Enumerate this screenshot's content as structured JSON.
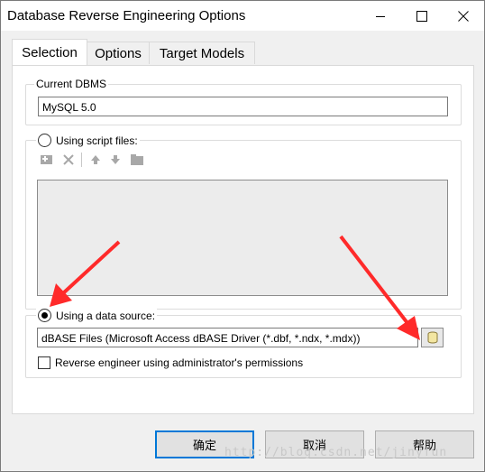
{
  "window": {
    "title": "Database Reverse Engineering Options",
    "minimize_icon": "minimize-icon",
    "maximize_icon": "maximize-icon",
    "close_icon": "close-icon"
  },
  "tabs": [
    {
      "label": "Selection",
      "active": true
    },
    {
      "label": "Options",
      "active": false
    },
    {
      "label": "Target Models",
      "active": false
    }
  ],
  "current_dbms": {
    "legend": "Current DBMS",
    "value": "MySQL 5.0"
  },
  "script_files": {
    "label": "Using script files:",
    "selected": false,
    "toolbar_icons": [
      "add-file-icon",
      "delete-icon",
      "move-up-icon",
      "move-down-icon",
      "folder-icon"
    ]
  },
  "data_source": {
    "label": "Using a data source:",
    "selected": true,
    "value": "dBASE Files (Microsoft Access dBASE Driver (*.dbf, *.ndx, *.mdx))",
    "browse_icon": "database-icon",
    "admin_checkbox_label": "Reverse engineer using administrator's permissions",
    "admin_checked": false
  },
  "buttons": {
    "ok": "确定",
    "cancel": "取消",
    "help": "帮助"
  },
  "watermark": "http://blog.csdn.net/jinyfun",
  "annotation_color": "#ff2a2a"
}
